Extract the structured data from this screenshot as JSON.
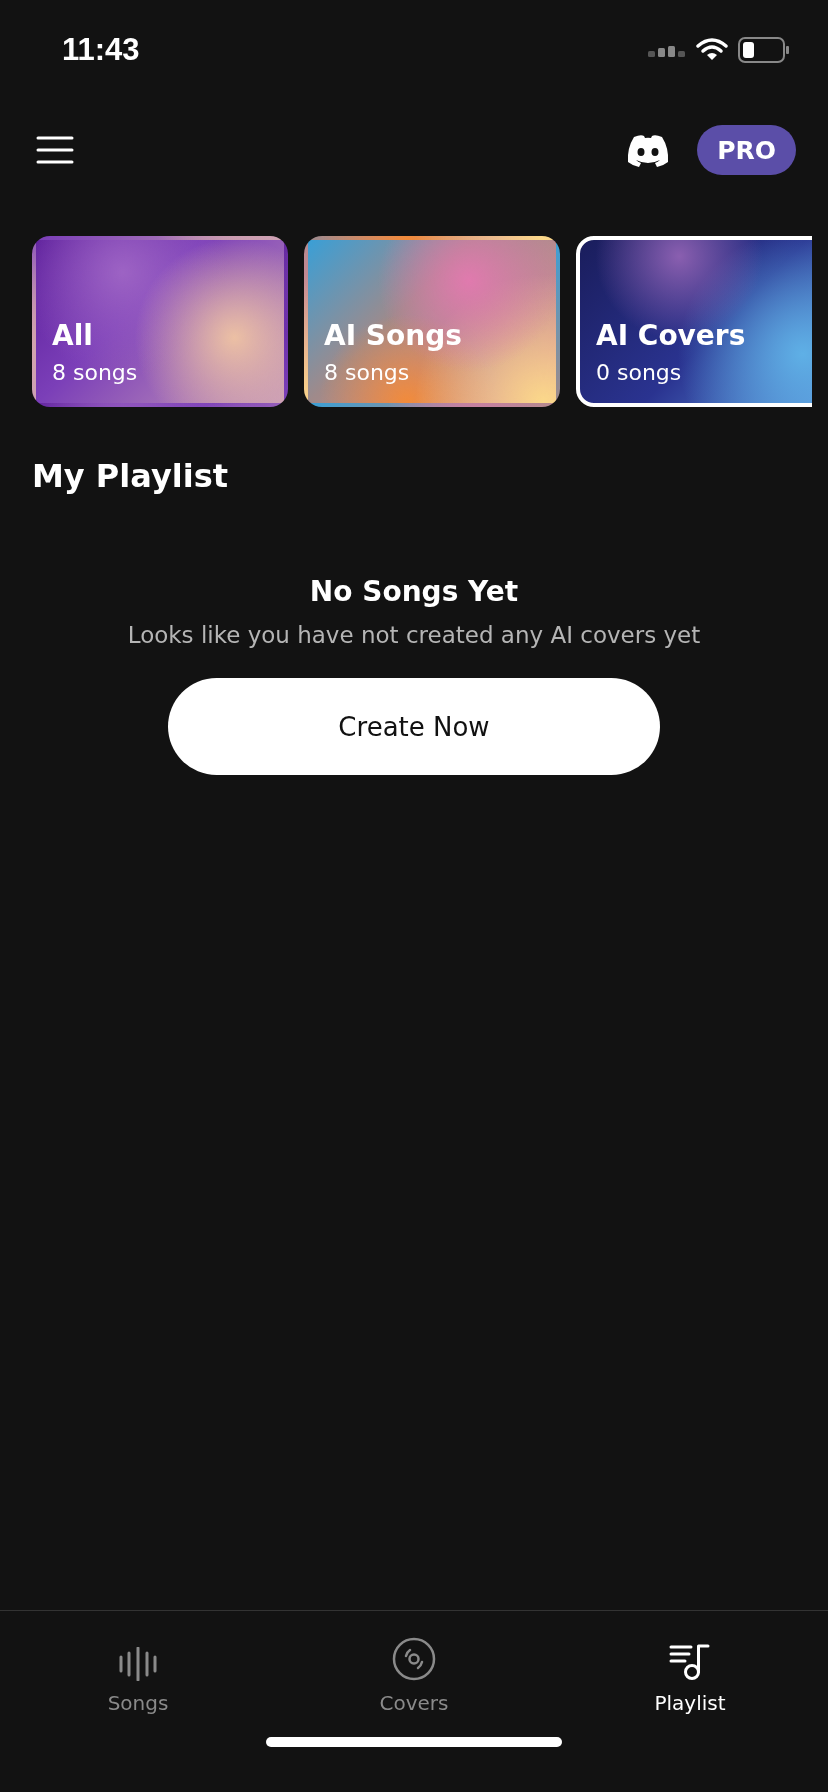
{
  "status_bar": {
    "time": "11:43"
  },
  "header": {
    "badge": "PRO"
  },
  "categories": [
    {
      "title": "All",
      "count": "8 songs",
      "selected": false
    },
    {
      "title": "AI Songs",
      "count": "8 songs",
      "selected": false
    },
    {
      "title": "AI Covers",
      "count": "0 songs",
      "selected": true
    }
  ],
  "section_title": "My Playlist",
  "empty_state": {
    "title": "No Songs Yet",
    "message": "Looks like you have not created any AI covers yet",
    "button": "Create Now"
  },
  "tabs": [
    {
      "label": "Songs",
      "selected": false
    },
    {
      "label": "Covers",
      "selected": false
    },
    {
      "label": "Playlist",
      "selected": true
    }
  ]
}
